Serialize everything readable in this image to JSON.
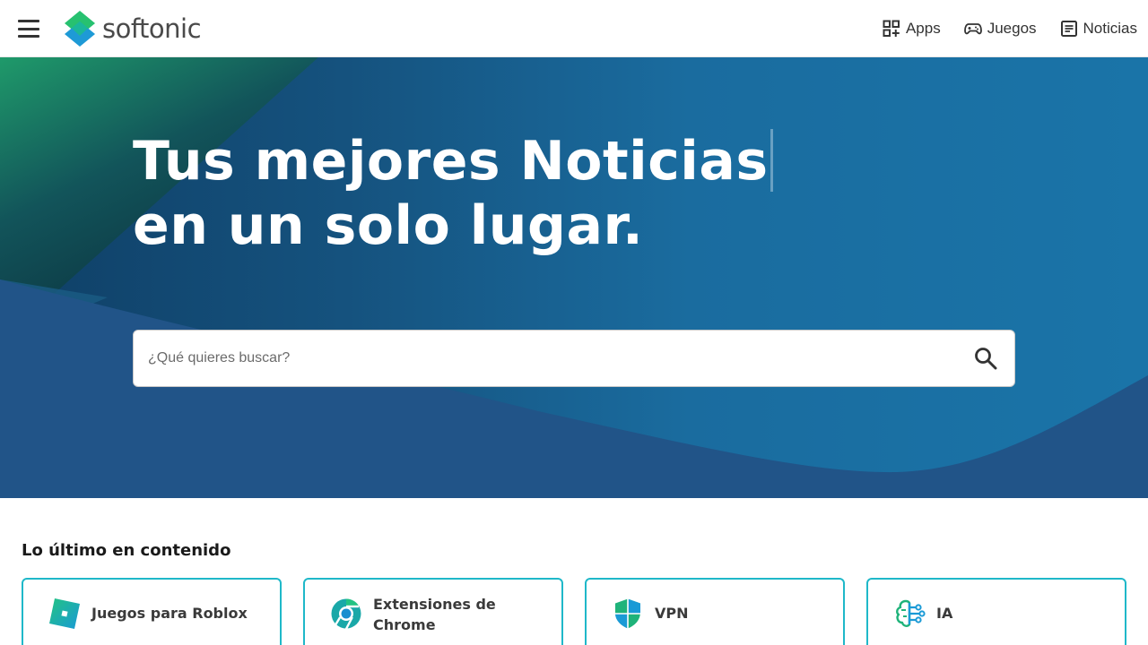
{
  "header": {
    "logo_text": "softonic",
    "nav": [
      {
        "label": "Apps",
        "icon": "apps-grid-icon"
      },
      {
        "label": "Juegos",
        "icon": "gamepad-icon"
      },
      {
        "label": "Noticias",
        "icon": "news-article-icon"
      }
    ]
  },
  "hero": {
    "title_line1": "Tus mejores Noticias",
    "title_line2": "en un solo lugar.",
    "search_placeholder": "¿Qué quieres buscar?"
  },
  "content": {
    "section_title": "Lo último en contenido",
    "cards": [
      {
        "label": "Juegos para Roblox",
        "icon": "roblox-icon"
      },
      {
        "label": "Extensiones de Chrome",
        "icon": "chrome-icon"
      },
      {
        "label": "VPN",
        "icon": "shield-icon"
      },
      {
        "label": "IA",
        "icon": "ai-brain-icon"
      }
    ]
  },
  "colors": {
    "hero_blue": "#1c73a6",
    "hero_dark": "#204f80",
    "accent_green": "#1fb37a",
    "card_border": "#1fb8c9"
  }
}
